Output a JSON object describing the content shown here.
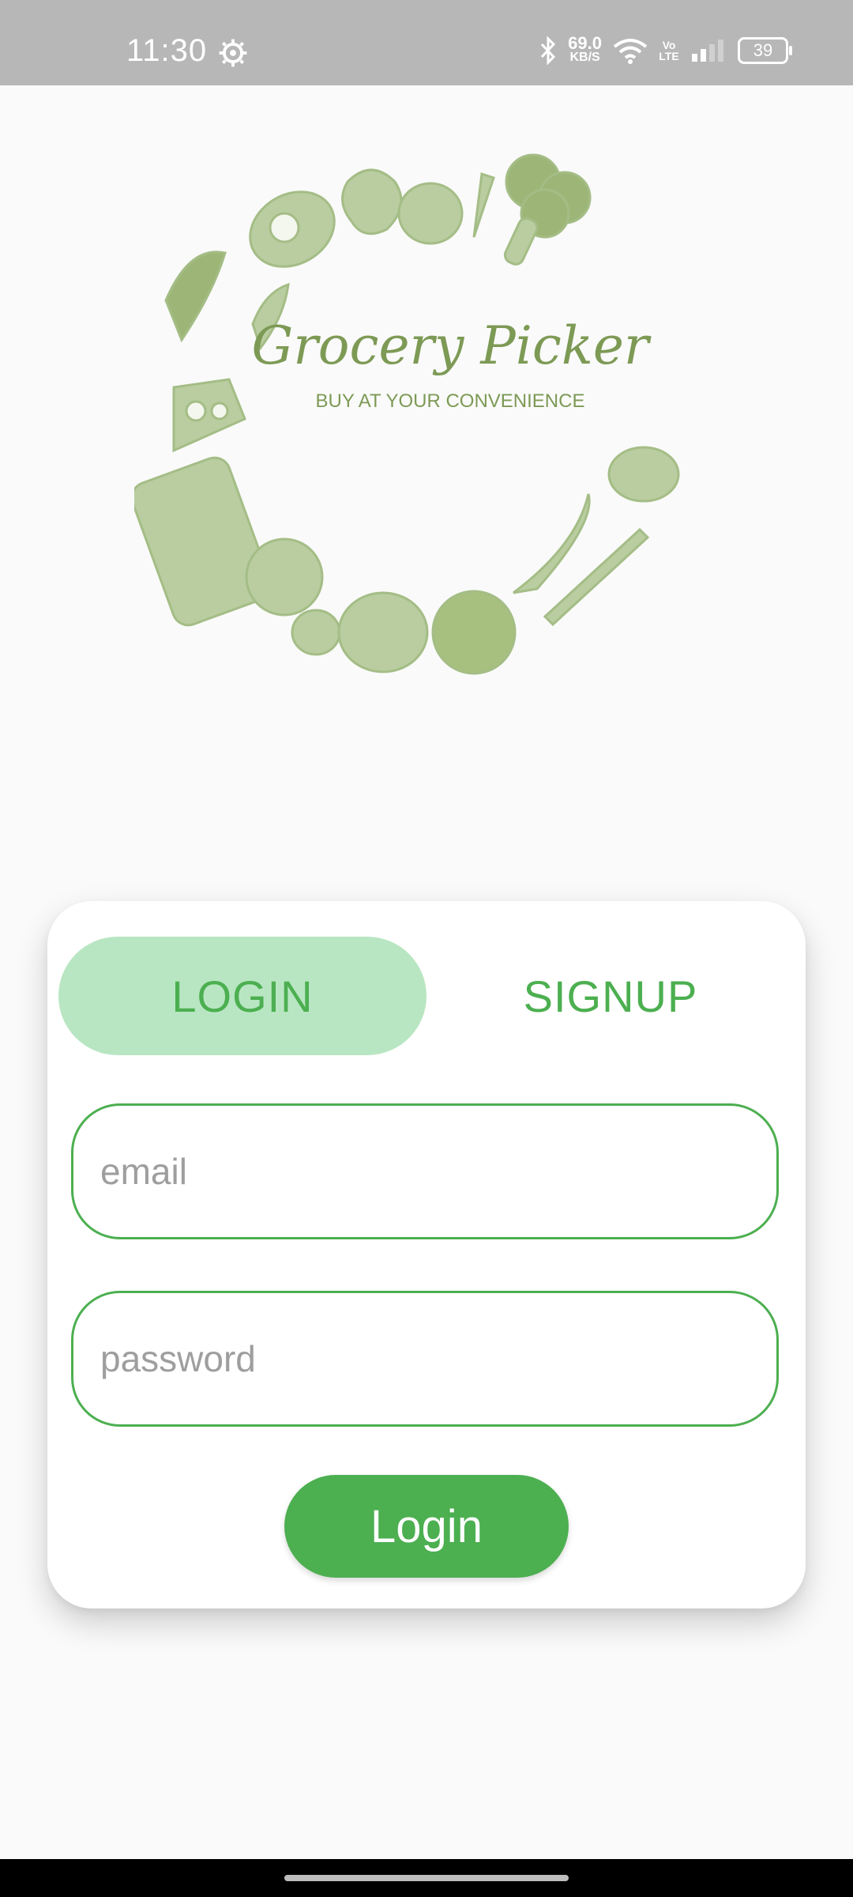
{
  "status_bar": {
    "time": "11:30",
    "net_speed": "69.0",
    "net_unit": "KB/S",
    "volte": "Vo LTE",
    "battery": "39"
  },
  "logo": {
    "title": "Grocery Picker",
    "tagline": "BUY AT YOUR CONVENIENCE"
  },
  "auth": {
    "tabs": {
      "login": "LOGIN",
      "signup": "SIGNUP"
    },
    "email_placeholder": "email",
    "password_placeholder": "password",
    "login_button": "Login"
  },
  "colors": {
    "accent": "#4caf50",
    "tab_active_bg": "#b8e6c2",
    "logo_green": "#7d9a55",
    "logo_light": "#b9cda0"
  }
}
